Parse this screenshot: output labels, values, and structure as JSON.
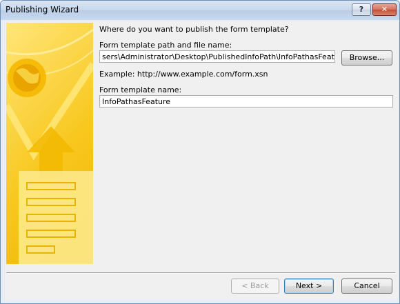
{
  "window": {
    "title": "Publishing Wizard"
  },
  "titlebar": {
    "help_label": "?",
    "close_label": "✕"
  },
  "main": {
    "question": "Where do you want to publish the form template?",
    "path_label": "Form template path and file name:",
    "path_value": "sers\\Administrator\\Desktop\\PublishedInfoPath\\InfoPathasFeature.xsn",
    "browse_label": "Browse...",
    "example_text": "Example: http://www.example.com/form.xsn",
    "name_label": "Form template name:",
    "name_value": "InfoPathasFeature"
  },
  "footer": {
    "back_label": "< Back",
    "next_label": "Next >",
    "cancel_label": "Cancel"
  },
  "colors": {
    "banner": "#f8c820",
    "accent": "#3c7fb1"
  }
}
